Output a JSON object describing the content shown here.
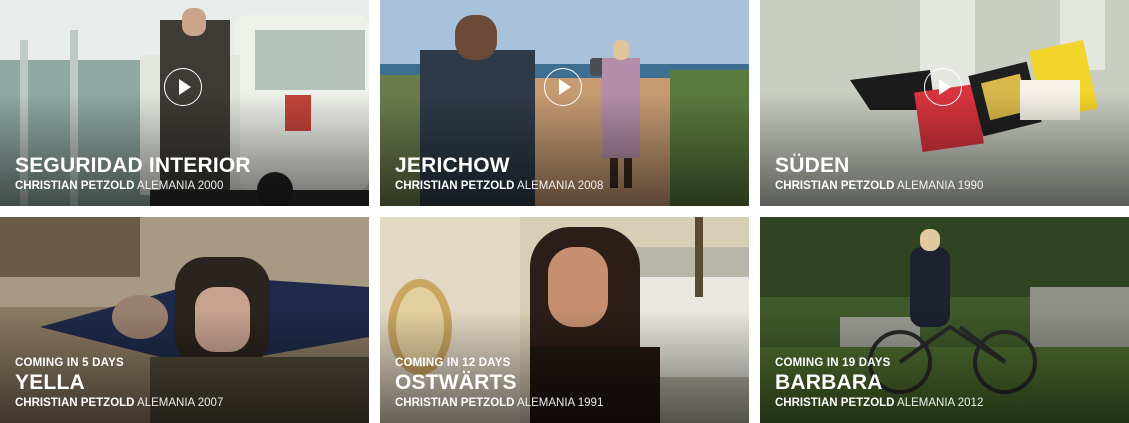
{
  "films": [
    {
      "title": "SEGURIDAD INTERIOR",
      "director": "CHRISTIAN PETZOLD",
      "country_year": "ALEMANIA 2000",
      "coming": "",
      "playable": true
    },
    {
      "title": "JERICHOW",
      "director": "CHRISTIAN PETZOLD",
      "country_year": "ALEMANIA 2008",
      "coming": "",
      "playable": true
    },
    {
      "title": "SÜDEN",
      "director": "CHRISTIAN PETZOLD",
      "country_year": "ALEMANIA 1990",
      "coming": "",
      "playable": true
    },
    {
      "title": "YELLA",
      "director": "CHRISTIAN PETZOLD",
      "country_year": "ALEMANIA 2007",
      "coming": "COMING IN 5 DAYS",
      "playable": false
    },
    {
      "title": "OSTWÄRTS",
      "director": "CHRISTIAN PETZOLD",
      "country_year": "ALEMANIA 1991",
      "coming": "COMING IN 12 DAYS",
      "playable": false
    },
    {
      "title": "BARBARA",
      "director": "CHRISTIAN PETZOLD",
      "country_year": "ALEMANIA 2012",
      "coming": "COMING IN 19 DAYS",
      "playable": false
    }
  ],
  "icons": {
    "play": "play-circle-icon"
  }
}
